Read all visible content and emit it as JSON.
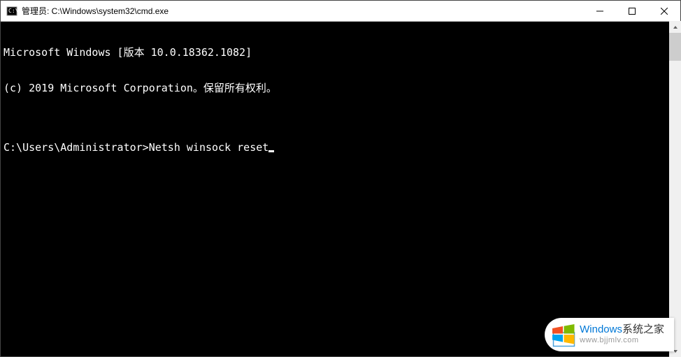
{
  "titlebar": {
    "title": "管理员: C:\\Windows\\system32\\cmd.exe"
  },
  "terminal": {
    "line1": "Microsoft Windows [版本 10.0.18362.1082]",
    "line2": "(c) 2019 Microsoft Corporation。保留所有权利。",
    "blank": "",
    "prompt": "C:\\Users\\Administrator>",
    "command": "Netsh winsock reset"
  },
  "watermark": {
    "brand_prefix": "Windows",
    "brand_suffix": "系统之家",
    "url": "www.bjjmlv.com"
  }
}
